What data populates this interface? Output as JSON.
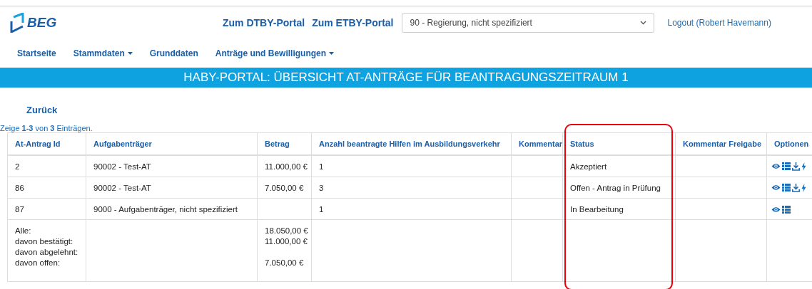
{
  "header": {
    "logo_text": "BEG",
    "portal_links": [
      "Zum DTBY-Portal",
      "Zum ETBY-Portal"
    ],
    "organisation_select": {
      "value": "90 - Regierung, nicht spezifiziert"
    },
    "logout": "Logout (Robert Havemann)"
  },
  "nav": [
    {
      "label": "Startseite",
      "dropdown": false
    },
    {
      "label": "Stammdaten",
      "dropdown": true
    },
    {
      "label": "Grunddaten",
      "dropdown": false
    },
    {
      "label": "Anträge und Bewilligungen",
      "dropdown": true
    }
  ],
  "banner": "HABY-PORTAL: ÜBERSICHT AT-ANTRÄGE FÜR BEANTRAGUNGSZEITRAUM 1",
  "back_link": "Zurück",
  "summary_text": "Zeige **1-3** von **3** Einträgen.",
  "table": {
    "columns": [
      "At-Antrag Id",
      "Aufgabenträger",
      "Betrag",
      "Anzahl beantragte Hilfen im Ausbildungsverkehr",
      "Kommentar",
      "Status",
      "Kommentar Freigabe",
      "Optionen"
    ],
    "rows": [
      {
        "id": "2",
        "aufgabentraeger": "90002 - Test-AT",
        "betrag": "11.000,00 €",
        "anzahl": "1",
        "status": "Akzeptiert",
        "options": [
          {
            "kind": "view"
          },
          {
            "kind": "list"
          },
          {
            "kind": "download"
          },
          {
            "kind": "action"
          }
        ]
      },
      {
        "id": "86",
        "aufgabentraeger": "90002 - Test-AT",
        "betrag": "7.050,00 €",
        "anzahl": "3",
        "status": "Offen - Antrag in Prüfung",
        "options": [
          {
            "kind": "view"
          },
          {
            "kind": "list"
          },
          {
            "kind": "download"
          },
          {
            "kind": "action"
          }
        ]
      },
      {
        "id": "87",
        "aufgabentraeger": "9000 - Aufgabenträger, nicht spezifiziert",
        "anzahl": "1",
        "status": "In Bearbeitung",
        "options": [
          {
            "kind": "view"
          },
          {
            "kind": "list"
          }
        ]
      }
    ],
    "totals": [
      {
        "label": "Alle:",
        "amount": "18.050,00 €"
      },
      {
        "label": "davon bestätigt:",
        "amount": "11.000,00 €"
      },
      {
        "label": "davon abgelehnt:"
      },
      {
        "label": "davon offen:",
        "amount": "7.050,00 €"
      }
    ]
  }
}
